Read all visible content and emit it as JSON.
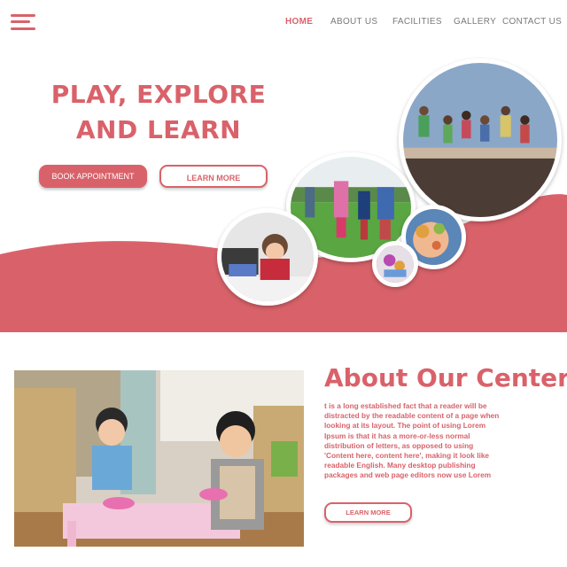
{
  "nav": {
    "items": [
      {
        "label": "HOME",
        "active": true
      },
      {
        "label": "ABOUT US",
        "active": false
      },
      {
        "label": "FACILITIES",
        "active": false
      },
      {
        "label": "GALLERY",
        "active": false
      },
      {
        "label": "CONTACT US",
        "active": false
      }
    ]
  },
  "hero": {
    "title_line1": "PLAY, EXPLORE",
    "title_line2": "AND LEARN",
    "book_button": "BOOK  APPOINTMENT",
    "learn_button": "LEARN MORE"
  },
  "about": {
    "title": "About Our Center",
    "body": "t is a long established fact that a reader will be distracted by the readable content of a page when looking at its layout. The point of using Lorem Ipsum is that it has a more-or-less normal distribution of letters, as opposed to using 'Content here, content here', making it look like readable English. Many desktop publishing packages and web page editors now use Lorem",
    "learn_button": "LEARN MORE"
  },
  "colors": {
    "accent": "#d9626a",
    "nav_text": "#7a7a7a",
    "background": "#ffffff"
  },
  "icons": {
    "menu": "hamburger-menu-icon"
  }
}
